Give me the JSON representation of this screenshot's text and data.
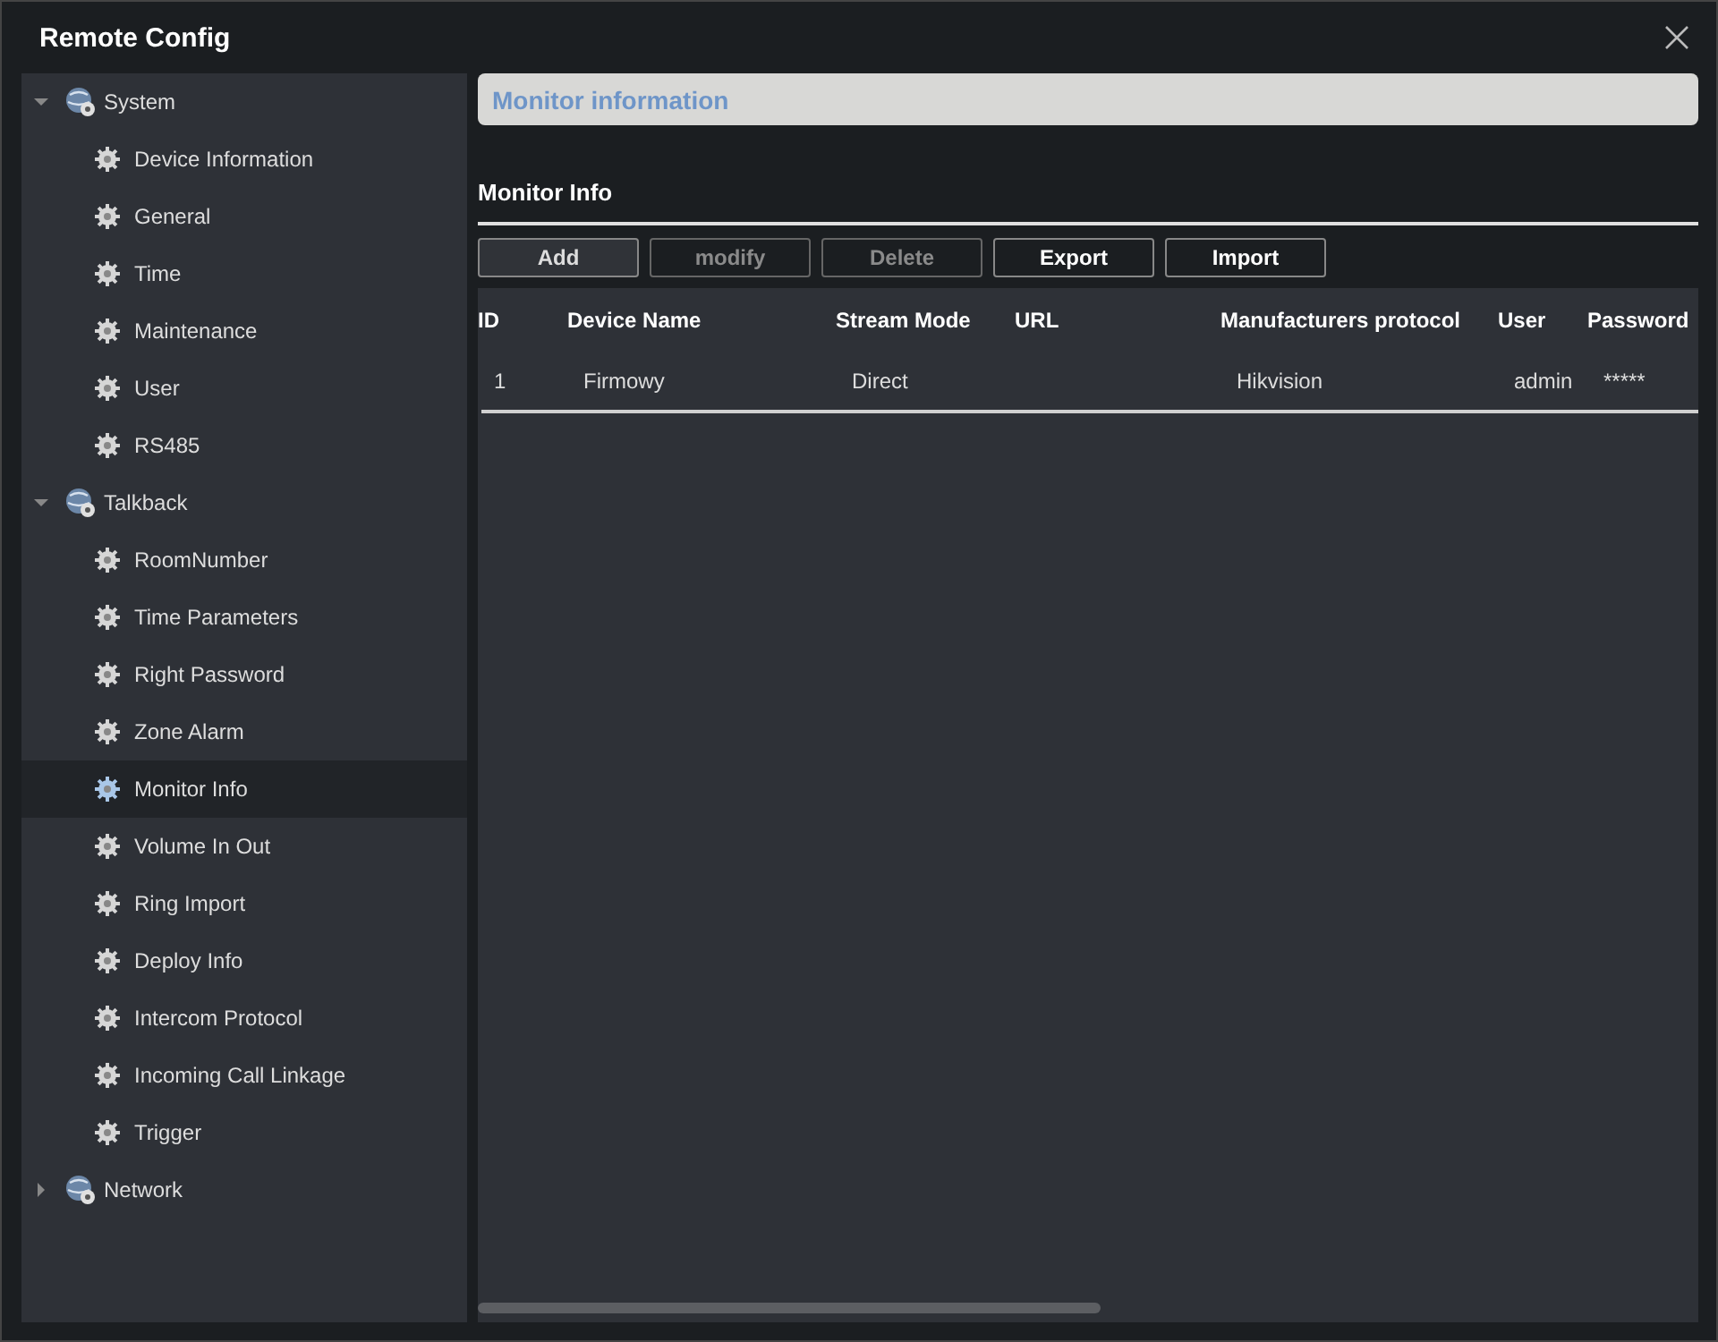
{
  "window": {
    "title": "Remote Config"
  },
  "tree": [
    {
      "label": "System",
      "expanded": true,
      "children": [
        {
          "label": "Device Information",
          "selected": false
        },
        {
          "label": "General",
          "selected": false
        },
        {
          "label": "Time",
          "selected": false
        },
        {
          "label": "Maintenance",
          "selected": false
        },
        {
          "label": "User",
          "selected": false
        },
        {
          "label": "RS485",
          "selected": false
        }
      ]
    },
    {
      "label": "Talkback",
      "expanded": true,
      "children": [
        {
          "label": "RoomNumber",
          "selected": false
        },
        {
          "label": "Time Parameters",
          "selected": false
        },
        {
          "label": "Right Password",
          "selected": false
        },
        {
          "label": "Zone Alarm",
          "selected": false
        },
        {
          "label": "Monitor Info",
          "selected": true
        },
        {
          "label": "Volume In Out",
          "selected": false
        },
        {
          "label": "Ring Import",
          "selected": false
        },
        {
          "label": "Deploy Info",
          "selected": false
        },
        {
          "label": "Intercom Protocol",
          "selected": false
        },
        {
          "label": "Incoming Call Linkage",
          "selected": false
        },
        {
          "label": "Trigger",
          "selected": false
        }
      ]
    },
    {
      "label": "Network",
      "expanded": false
    }
  ],
  "page_header": "Monitor information",
  "section_title": "Monitor Info",
  "buttons": [
    {
      "label": "Add",
      "kind": "soft",
      "disabled": false
    },
    {
      "label": "modify",
      "kind": "strong",
      "disabled": true
    },
    {
      "label": "Delete",
      "kind": "strong",
      "disabled": true
    },
    {
      "label": "Export",
      "kind": "strong",
      "disabled": false
    },
    {
      "label": "Import",
      "kind": "strong",
      "disabled": false
    }
  ],
  "table": {
    "columns": [
      "ID",
      "Device Name",
      "Stream Mode",
      "URL",
      "Manufacturers protocol",
      "User",
      "Password"
    ],
    "rows": [
      [
        "1",
        "Firmowy",
        "Direct",
        "",
        "Hikvision",
        "admin",
        "*****"
      ]
    ]
  }
}
